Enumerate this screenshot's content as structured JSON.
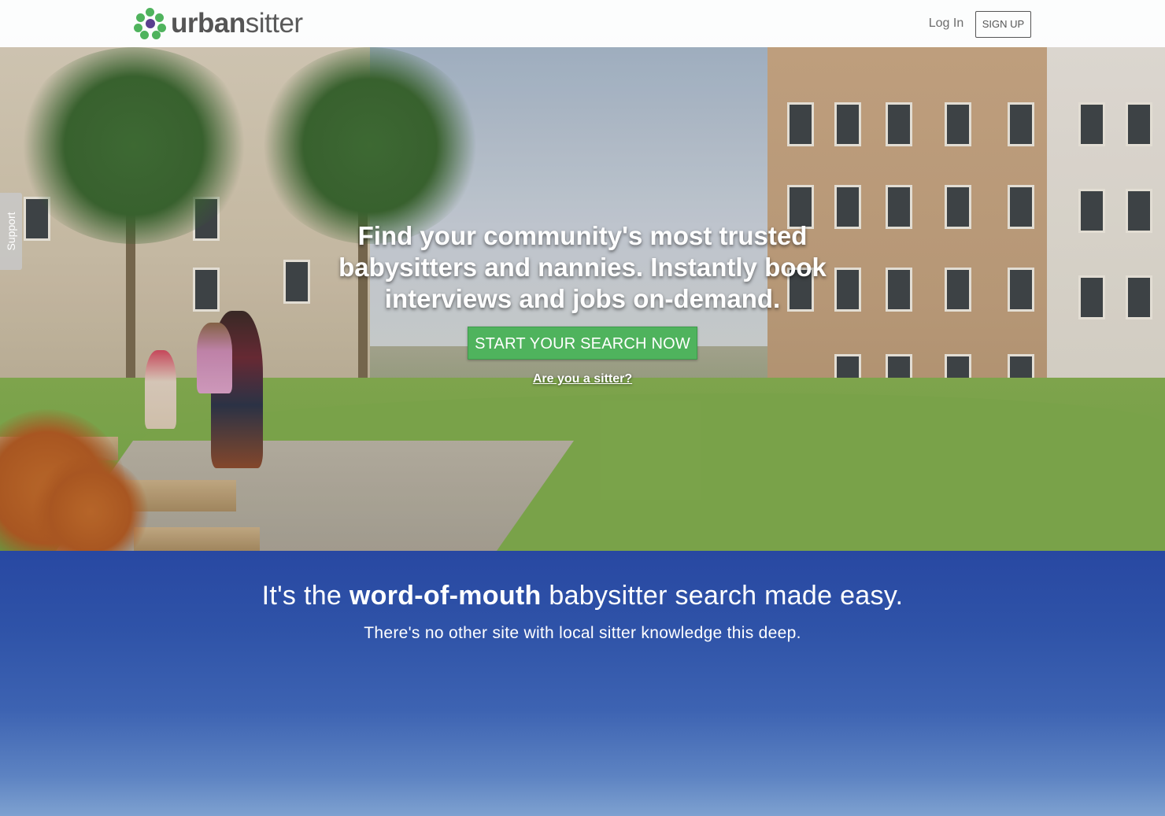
{
  "header": {
    "brand_bold": "urban",
    "brand_light": "sitter",
    "login_label": "Log In",
    "signup_label": "SIGN UP"
  },
  "support_tab": {
    "label": "Support"
  },
  "hero": {
    "title": "Find your community's most trusted babysitters and nannies. Instantly book interviews and jobs on-demand.",
    "cta_label": "START YOUR SEARCH NOW",
    "sitter_link": "Are you a sitter?"
  },
  "band": {
    "headline_pre": "It's the ",
    "headline_bold": "word-of-mouth",
    "headline_post": " babysitter search made easy.",
    "subheadline": "There's no other site with local sitter knowledge this deep."
  },
  "colors": {
    "brand_green": "#4fb35d",
    "band_blue": "#2c4ea5",
    "logo_purple": "#5b3f8f"
  }
}
